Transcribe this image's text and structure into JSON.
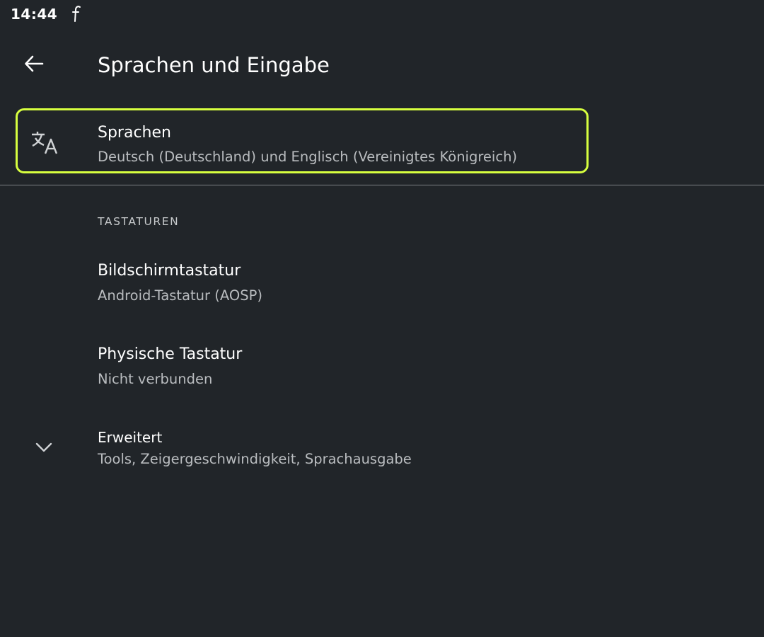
{
  "status_bar": {
    "time": "14:44",
    "notification_icon": "f-notification-icon"
  },
  "app_bar": {
    "back_icon": "arrow-back-icon",
    "title": "Sprachen und Eingabe"
  },
  "languages": {
    "icon": "translate-icon",
    "title": "Sprachen",
    "summary": "Deutsch (Deutschland) und Englisch (Vereinigtes Königreich)",
    "highlight_color": "#d7ff3f"
  },
  "keyboards": {
    "header": "TASTATUREN",
    "items": [
      {
        "title": "Bildschirmtastatur",
        "summary": "Android-Tastatur (AOSP)"
      },
      {
        "title": "Physische Tastatur",
        "summary": "Nicht verbunden"
      }
    ]
  },
  "advanced": {
    "icon": "chevron-down-icon",
    "title": "Erweitert",
    "summary": "Tools, Zeigergeschwindigkeit, Sprachausgabe"
  },
  "colors": {
    "background": "#212529",
    "primary_text": "#ffffff",
    "secondary_text": "#b9bcbf",
    "divider": "#7d8185"
  }
}
